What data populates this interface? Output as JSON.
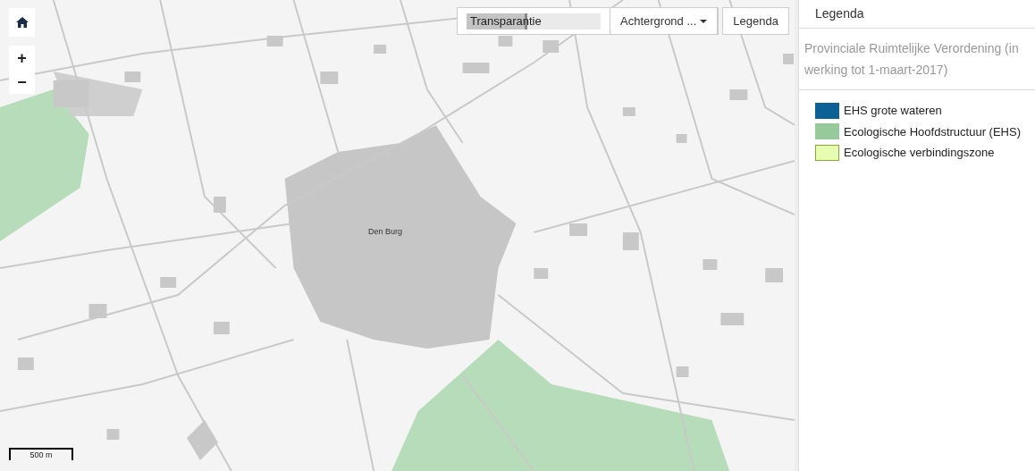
{
  "map": {
    "place_label": "Den Burg",
    "scale_bar": "500 m",
    "zoom_in": "+",
    "zoom_out": "−"
  },
  "toolbar": {
    "transparency": {
      "label": "Transparantie",
      "level": 0.45
    },
    "background_button": "Achtergrond ...",
    "legend_button": "Legenda"
  },
  "legend": {
    "title": "Legenda",
    "layer_title": "Provinciale Ruimtelijke Verordening (in werking tot 1-maart-2017)",
    "items": [
      {
        "label": "EHS grote wateren",
        "color": "#0b6196"
      },
      {
        "label": "Ecologische Hoofdstructuur (EHS)",
        "color": "#97ca9b"
      },
      {
        "label": "Ecologische verbindingszone",
        "color": "#e6fdb2"
      }
    ]
  }
}
